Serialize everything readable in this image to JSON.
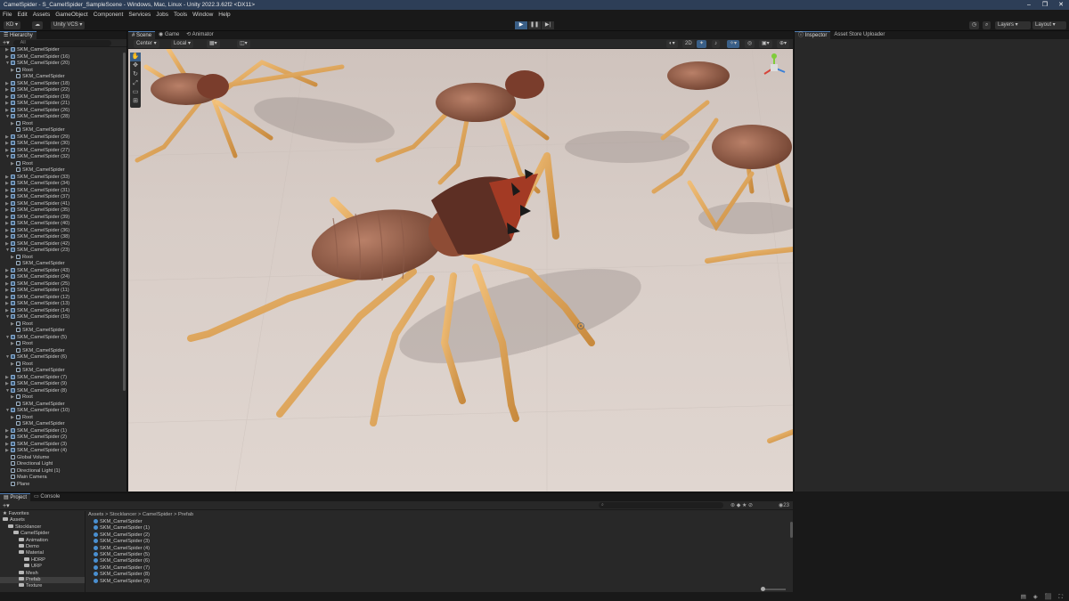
{
  "window": {
    "title": "CamelSpider - S_CamelSpider_SampleScene - Windows, Mac, Linux - Unity 2022.3.62f2 <DX11>",
    "controls": [
      "–",
      "❐",
      "✕"
    ]
  },
  "menu": [
    "File",
    "Edit",
    "Assets",
    "GameObject",
    "Component",
    "Services",
    "Jobs",
    "Tools",
    "Window",
    "Help"
  ],
  "toolbar": {
    "account": "KD ▾",
    "vcs": "Unity VCS ▾",
    "layers": "Layers",
    "layout": "Layout"
  },
  "hierarchy": {
    "tab": "Hierarchy",
    "search_placeholder": "All",
    "rows": [
      {
        "label": "SKM_CamelSpider",
        "indent": 1,
        "arrow": "▶",
        "type": "prefab"
      },
      {
        "label": "SKM_CamelSpider (16)",
        "indent": 1,
        "arrow": "▶",
        "type": "prefab"
      },
      {
        "label": "SKM_CamelSpider (20)",
        "indent": 1,
        "arrow": "▼",
        "type": "prefab"
      },
      {
        "label": "Root",
        "indent": 2,
        "arrow": "▶",
        "type": "obj"
      },
      {
        "label": "SKM_CamelSpider",
        "indent": 2,
        "arrow": "",
        "type": "obj"
      },
      {
        "label": "SKM_CamelSpider (18)",
        "indent": 1,
        "arrow": "▶",
        "type": "prefab"
      },
      {
        "label": "SKM_CamelSpider (22)",
        "indent": 1,
        "arrow": "▶",
        "type": "prefab"
      },
      {
        "label": "SKM_CamelSpider (19)",
        "indent": 1,
        "arrow": "▶",
        "type": "prefab"
      },
      {
        "label": "SKM_CamelSpider (21)",
        "indent": 1,
        "arrow": "▶",
        "type": "prefab"
      },
      {
        "label": "SKM_CamelSpider (26)",
        "indent": 1,
        "arrow": "▶",
        "type": "prefab"
      },
      {
        "label": "SKM_CamelSpider (28)",
        "indent": 1,
        "arrow": "▼",
        "type": "prefab"
      },
      {
        "label": "Root",
        "indent": 2,
        "arrow": "▶",
        "type": "obj"
      },
      {
        "label": "SKM_CamelSpider",
        "indent": 2,
        "arrow": "",
        "type": "obj"
      },
      {
        "label": "SKM_CamelSpider (29)",
        "indent": 1,
        "arrow": "▶",
        "type": "prefab"
      },
      {
        "label": "SKM_CamelSpider (30)",
        "indent": 1,
        "arrow": "▶",
        "type": "prefab"
      },
      {
        "label": "SKM_CamelSpider (27)",
        "indent": 1,
        "arrow": "▶",
        "type": "prefab"
      },
      {
        "label": "SKM_CamelSpider (32)",
        "indent": 1,
        "arrow": "▼",
        "type": "prefab"
      },
      {
        "label": "Root",
        "indent": 2,
        "arrow": "▶",
        "type": "obj"
      },
      {
        "label": "SKM_CamelSpider",
        "indent": 2,
        "arrow": "",
        "type": "obj"
      },
      {
        "label": "SKM_CamelSpider (33)",
        "indent": 1,
        "arrow": "▶",
        "type": "prefab"
      },
      {
        "label": "SKM_CamelSpider (34)",
        "indent": 1,
        "arrow": "▶",
        "type": "prefab"
      },
      {
        "label": "SKM_CamelSpider (31)",
        "indent": 1,
        "arrow": "▶",
        "type": "prefab"
      },
      {
        "label": "SKM_CamelSpider (37)",
        "indent": 1,
        "arrow": "▶",
        "type": "prefab"
      },
      {
        "label": "SKM_CamelSpider (41)",
        "indent": 1,
        "arrow": "▶",
        "type": "prefab"
      },
      {
        "label": "SKM_CamelSpider (35)",
        "indent": 1,
        "arrow": "▶",
        "type": "prefab"
      },
      {
        "label": "SKM_CamelSpider (39)",
        "indent": 1,
        "arrow": "▶",
        "type": "prefab"
      },
      {
        "label": "SKM_CamelSpider (40)",
        "indent": 1,
        "arrow": "▶",
        "type": "prefab"
      },
      {
        "label": "SKM_CamelSpider (36)",
        "indent": 1,
        "arrow": "▶",
        "type": "prefab"
      },
      {
        "label": "SKM_CamelSpider (38)",
        "indent": 1,
        "arrow": "▶",
        "type": "prefab"
      },
      {
        "label": "SKM_CamelSpider (42)",
        "indent": 1,
        "arrow": "▶",
        "type": "prefab"
      },
      {
        "label": "SKM_CamelSpider (23)",
        "indent": 1,
        "arrow": "▼",
        "type": "prefab"
      },
      {
        "label": "Root",
        "indent": 2,
        "arrow": "▶",
        "type": "obj"
      },
      {
        "label": "SKM_CamelSpider",
        "indent": 2,
        "arrow": "",
        "type": "obj"
      },
      {
        "label": "SKM_CamelSpider (43)",
        "indent": 1,
        "arrow": "▶",
        "type": "prefab"
      },
      {
        "label": "SKM_CamelSpider (24)",
        "indent": 1,
        "arrow": "▶",
        "type": "prefab"
      },
      {
        "label": "SKM_CamelSpider (25)",
        "indent": 1,
        "arrow": "▶",
        "type": "prefab"
      },
      {
        "label": "SKM_CamelSpider (11)",
        "indent": 1,
        "arrow": "▶",
        "type": "prefab"
      },
      {
        "label": "SKM_CamelSpider (12)",
        "indent": 1,
        "arrow": "▶",
        "type": "prefab"
      },
      {
        "label": "SKM_CamelSpider (13)",
        "indent": 1,
        "arrow": "▶",
        "type": "prefab"
      },
      {
        "label": "SKM_CamelSpider (14)",
        "indent": 1,
        "arrow": "▶",
        "type": "prefab"
      },
      {
        "label": "SKM_CamelSpider (15)",
        "indent": 1,
        "arrow": "▼",
        "type": "prefab"
      },
      {
        "label": "Root",
        "indent": 2,
        "arrow": "▶",
        "type": "obj"
      },
      {
        "label": "SKM_CamelSpider",
        "indent": 2,
        "arrow": "",
        "type": "obj"
      },
      {
        "label": "SKM_CamelSpider (5)",
        "indent": 1,
        "arrow": "▼",
        "type": "prefab"
      },
      {
        "label": "Root",
        "indent": 2,
        "arrow": "▶",
        "type": "obj"
      },
      {
        "label": "SKM_CamelSpider",
        "indent": 2,
        "arrow": "",
        "type": "obj"
      },
      {
        "label": "SKM_CamelSpider (6)",
        "indent": 1,
        "arrow": "▼",
        "type": "prefab"
      },
      {
        "label": "Root",
        "indent": 2,
        "arrow": "▶",
        "type": "obj"
      },
      {
        "label": "SKM_CamelSpider",
        "indent": 2,
        "arrow": "",
        "type": "obj"
      },
      {
        "label": "SKM_CamelSpider (7)",
        "indent": 1,
        "arrow": "▶",
        "type": "prefab"
      },
      {
        "label": "SKM_CamelSpider (9)",
        "indent": 1,
        "arrow": "▶",
        "type": "prefab"
      },
      {
        "label": "SKM_CamelSpider (8)",
        "indent": 1,
        "arrow": "▼",
        "type": "prefab"
      },
      {
        "label": "Root",
        "indent": 2,
        "arrow": "▶",
        "type": "obj"
      },
      {
        "label": "SKM_CamelSpider",
        "indent": 2,
        "arrow": "",
        "type": "obj"
      },
      {
        "label": "SKM_CamelSpider (10)",
        "indent": 1,
        "arrow": "▼",
        "type": "prefab"
      },
      {
        "label": "Root",
        "indent": 2,
        "arrow": "▶",
        "type": "obj"
      },
      {
        "label": "SKM_CamelSpider",
        "indent": 2,
        "arrow": "",
        "type": "obj"
      },
      {
        "label": "SKM_CamelSpider (1)",
        "indent": 1,
        "arrow": "▶",
        "type": "prefab"
      },
      {
        "label": "SKM_CamelSpider (2)",
        "indent": 1,
        "arrow": "▶",
        "type": "prefab"
      },
      {
        "label": "SKM_CamelSpider (3)",
        "indent": 1,
        "arrow": "▶",
        "type": "prefab"
      },
      {
        "label": "SKM_CamelSpider (4)",
        "indent": 1,
        "arrow": "▶",
        "type": "prefab"
      },
      {
        "label": "Global Volume",
        "indent": 1,
        "arrow": "",
        "type": "obj"
      },
      {
        "label": "Directional Light",
        "indent": 1,
        "arrow": "",
        "type": "obj"
      },
      {
        "label": "Directional Light (1)",
        "indent": 1,
        "arrow": "",
        "type": "obj"
      },
      {
        "label": "Main Camera",
        "indent": 1,
        "arrow": "",
        "type": "obj"
      },
      {
        "label": "Plane",
        "indent": 1,
        "arrow": "",
        "type": "obj"
      }
    ]
  },
  "scene": {
    "tabs": [
      "Scene",
      "Game",
      "Animator"
    ],
    "pivot": "Center ▾",
    "space": "Local ▾",
    "mode_2d": "2D"
  },
  "inspector": {
    "tabs": [
      "Inspector",
      "Asset Store Uploader"
    ]
  },
  "project": {
    "tabs": [
      "Project",
      "Console"
    ],
    "breadcrumb": "Assets > Stocklancer > CamelSpider > Prefab",
    "count": "23",
    "tree": [
      {
        "label": "★ Favorites",
        "indent": 0,
        "folder": false,
        "sel": false
      },
      {
        "label": "Assets",
        "indent": 0,
        "folder": true,
        "sel": false
      },
      {
        "label": "Stocklancer",
        "indent": 1,
        "folder": true,
        "sel": false
      },
      {
        "label": "CamelSpider",
        "indent": 2,
        "folder": true,
        "sel": false
      },
      {
        "label": "Animation",
        "indent": 3,
        "folder": true,
        "sel": false
      },
      {
        "label": "Demo",
        "indent": 3,
        "folder": true,
        "sel": false
      },
      {
        "label": "Material",
        "indent": 3,
        "folder": true,
        "sel": false
      },
      {
        "label": "HDRP",
        "indent": 4,
        "folder": true,
        "sel": false
      },
      {
        "label": "URP",
        "indent": 4,
        "folder": true,
        "sel": false
      },
      {
        "label": "Mesh",
        "indent": 3,
        "folder": true,
        "sel": false
      },
      {
        "label": "Prefab",
        "indent": 3,
        "folder": true,
        "sel": true
      },
      {
        "label": "Texture",
        "indent": 3,
        "folder": true,
        "sel": false
      }
    ],
    "assets": [
      "SKM_CamelSpider",
      "SKM_CamelSpider (1)",
      "SKM_CamelSpider (2)",
      "SKM_CamelSpider (3)",
      "SKM_CamelSpider (4)",
      "SKM_CamelSpider (5)",
      "SKM_CamelSpider (6)",
      "SKM_CamelSpider (7)",
      "SKM_CamelSpider (8)",
      "SKM_CamelSpider (9)"
    ]
  }
}
